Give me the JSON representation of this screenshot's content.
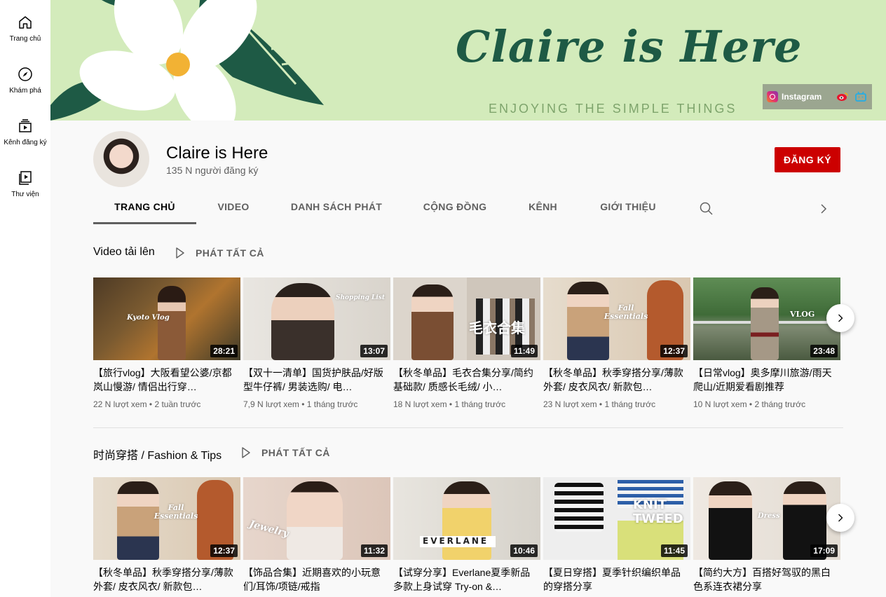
{
  "guide": [
    {
      "label": "Trang chủ",
      "icon": "home-icon"
    },
    {
      "label": "Khám phá",
      "icon": "compass-icon"
    },
    {
      "label": "Kênh đăng ký",
      "icon": "subscriptions-icon"
    },
    {
      "label": "Thư viện",
      "icon": "library-icon"
    }
  ],
  "banner": {
    "title": "Claire is Here",
    "subtitle": "ENJOYING THE SIMPLE THINGS",
    "instagram_label": "Instagram",
    "background": "#d3ebbb",
    "title_color": "#1e5a45"
  },
  "channel": {
    "name": "Claire is Here",
    "subscribers": "135 N người đăng ký",
    "subscribe_label": "ĐĂNG KÝ",
    "subscribe_color": "#cc0000"
  },
  "tabs": [
    {
      "label": "TRANG CHỦ"
    },
    {
      "label": "VIDEO"
    },
    {
      "label": "DANH SÁCH PHÁT"
    },
    {
      "label": "CỘNG ĐỒNG"
    },
    {
      "label": "KÊNH"
    },
    {
      "label": "GIỚI THIỆU"
    }
  ],
  "shelves": [
    {
      "title": "Video tải lên",
      "play_all": "PHÁT TẤT CẢ",
      "videos": [
        {
          "title": "【旅行vlog】大阪看望公婆/京都岚山慢游/ 情侣出行穿…",
          "duration": "28:21",
          "views": "22 N lượt xem",
          "age": "2 tuần trước",
          "overlay": "Kyoto Vlog"
        },
        {
          "title": "【双十一清单】国货护肤品/好版型牛仔裤/ 男装选购/ 电…",
          "duration": "13:07",
          "views": "7,9 N lượt xem",
          "age": "1 tháng trước",
          "overlay": "Shopping List"
        },
        {
          "title": "【秋冬单品】毛衣合集分享/简约基础款/ 质感长毛绒/ 小…",
          "duration": "11:49",
          "views": "18 N lượt xem",
          "age": "1 tháng trước",
          "overlay": "毛衣合集"
        },
        {
          "title": "【秋冬单品】秋季穿搭分享/薄款外套/ 皮衣风衣/ 新款包…",
          "duration": "12:37",
          "views": "23 N lượt xem",
          "age": "1 tháng trước",
          "overlay": "Fall Essentials"
        },
        {
          "title": "【日常vlog】奥多摩川旅游/雨天爬山/近期爱看剧推荐",
          "duration": "23:48",
          "views": "10 N lượt xem",
          "age": "2 tháng trước",
          "overlay": "VLOG"
        }
      ]
    },
    {
      "title": "时尚穿搭 / Fashion & Tips",
      "play_all": "PHÁT TẤT CẢ",
      "videos": [
        {
          "title": "【秋冬单品】秋季穿搭分享/薄款外套/ 皮衣风衣/ 新款包…",
          "duration": "12:37",
          "overlay": "Fall Essentials"
        },
        {
          "title": "【饰品合集】近期喜欢的小玩意们/耳饰/项链/戒指",
          "duration": "11:32",
          "overlay": "Jewelry"
        },
        {
          "title": "【试穿分享】Everlane夏季新品多款上身试穿 Try-on &…",
          "duration": "10:46",
          "overlay": "EVERLANE"
        },
        {
          "title": "【夏日穿搭】夏季针织编织单品的穿搭分享",
          "duration": "11:45",
          "overlay": "KNIT TWEED"
        },
        {
          "title": "【简约大方】百搭好驾驭的黑白色系连衣裙分享",
          "duration": "17:09",
          "overlay": "Dress"
        }
      ]
    }
  ]
}
